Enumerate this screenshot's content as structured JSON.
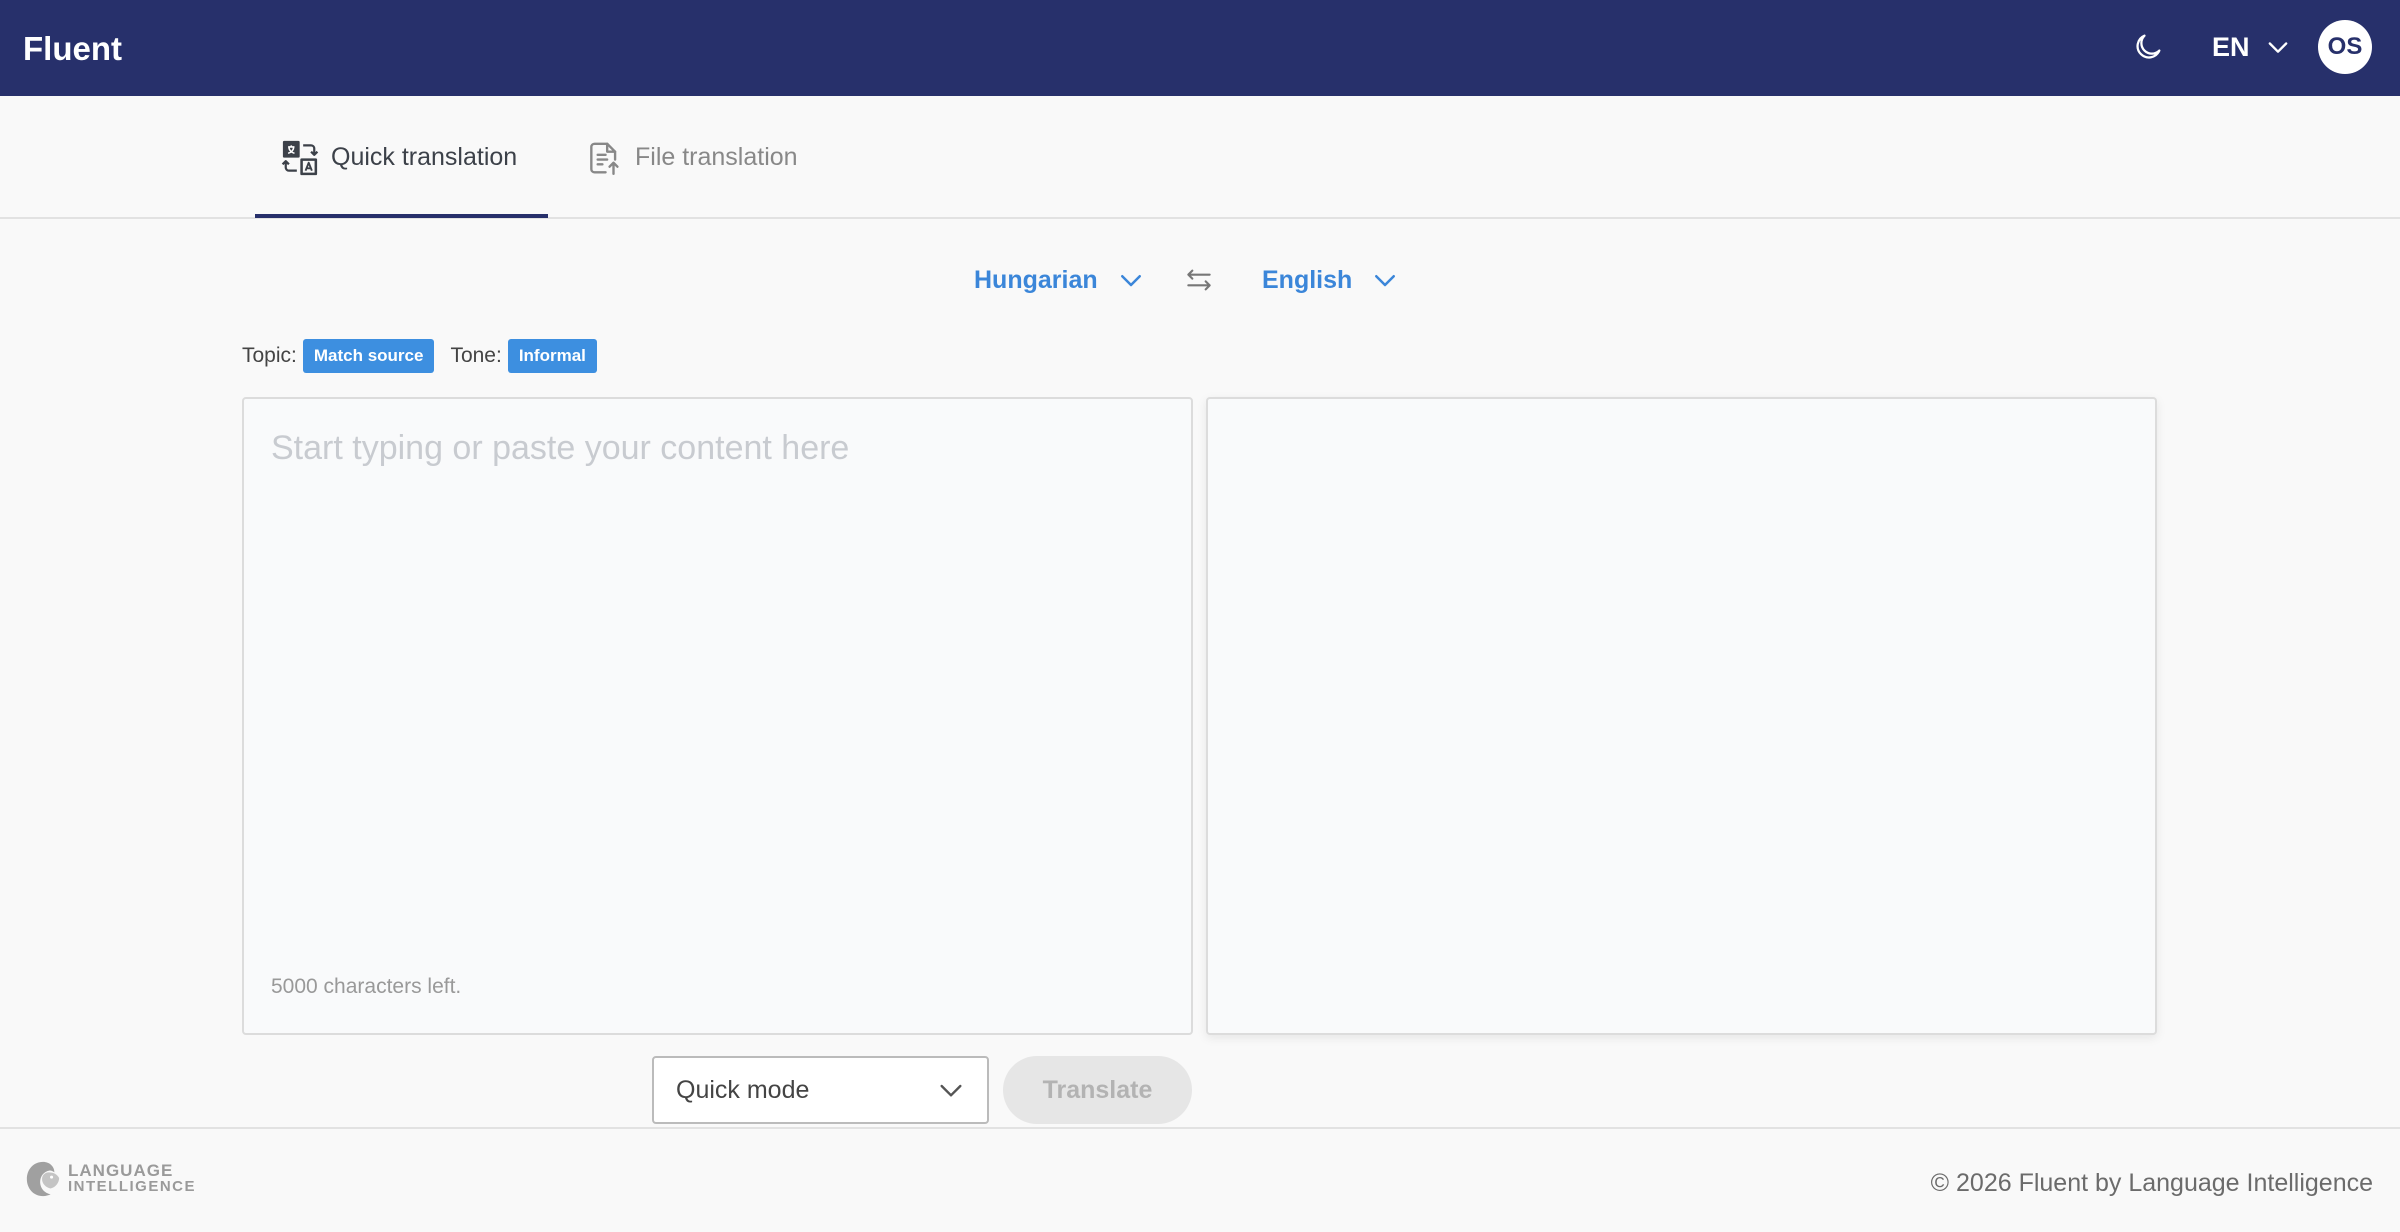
{
  "app": {
    "brand": "Fluent",
    "ui_language": "EN",
    "user_initials": "OS"
  },
  "tabs": [
    {
      "label": "Quick translation",
      "icon": "translate-icon",
      "active": true
    },
    {
      "label": "File translation",
      "icon": "file-upload-icon",
      "active": false
    }
  ],
  "languages": {
    "source": "Hungarian",
    "target": "English"
  },
  "options": {
    "topic_label": "Topic:",
    "topic_value": "Match source",
    "tone_label": "Tone:",
    "tone_value": "Informal"
  },
  "source_panel": {
    "value": "",
    "placeholder": "Start typing or paste your content here",
    "chars_left": "5000 characters left."
  },
  "target_panel": {
    "value": ""
  },
  "actions": {
    "mode": "Quick mode",
    "translate_label": "Translate",
    "translate_enabled": false
  },
  "footer": {
    "logo_line1": "LANGUAGE",
    "logo_line2": "INTELLIGENCE",
    "copyright": "© 2026 Fluent by Language Intelligence"
  },
  "colors": {
    "header_bg": "#27306b",
    "accent": "#3b86d9",
    "badge": "#3d8fe0"
  }
}
